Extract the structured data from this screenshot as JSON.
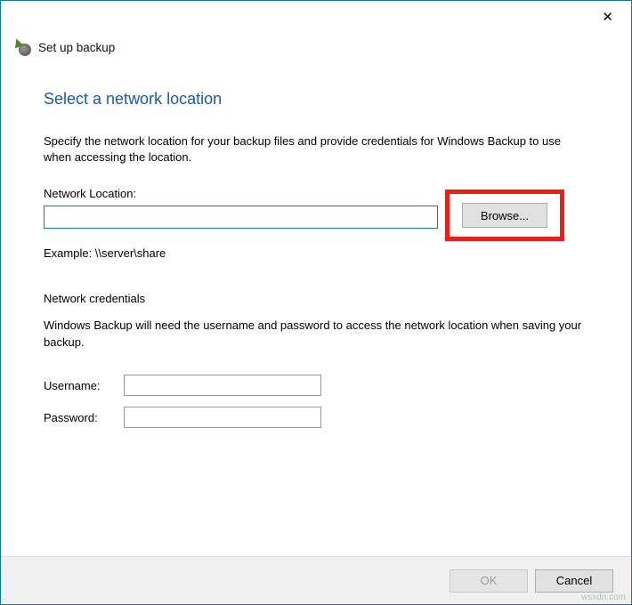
{
  "titlebar": {
    "close_glyph": "✕"
  },
  "wizard": {
    "title": "Set up backup"
  },
  "main": {
    "heading": "Select a network location",
    "instruction": "Specify the network location for your backup files and provide credentials for Windows Backup to use when accessing the location.",
    "network_location_label": "Network Location:",
    "network_location_value": "",
    "browse_label": "Browse...",
    "example_text": "Example: \\\\server\\share",
    "credentials_heading": "Network credentials",
    "credentials_instruction": "Windows Backup will need the username and password to access the network location when saving your backup.",
    "username_label": "Username:",
    "username_value": "",
    "password_label": "Password:",
    "password_value": ""
  },
  "footer": {
    "ok_label": "OK",
    "cancel_label": "Cancel"
  },
  "watermark": "wsxdn.com"
}
